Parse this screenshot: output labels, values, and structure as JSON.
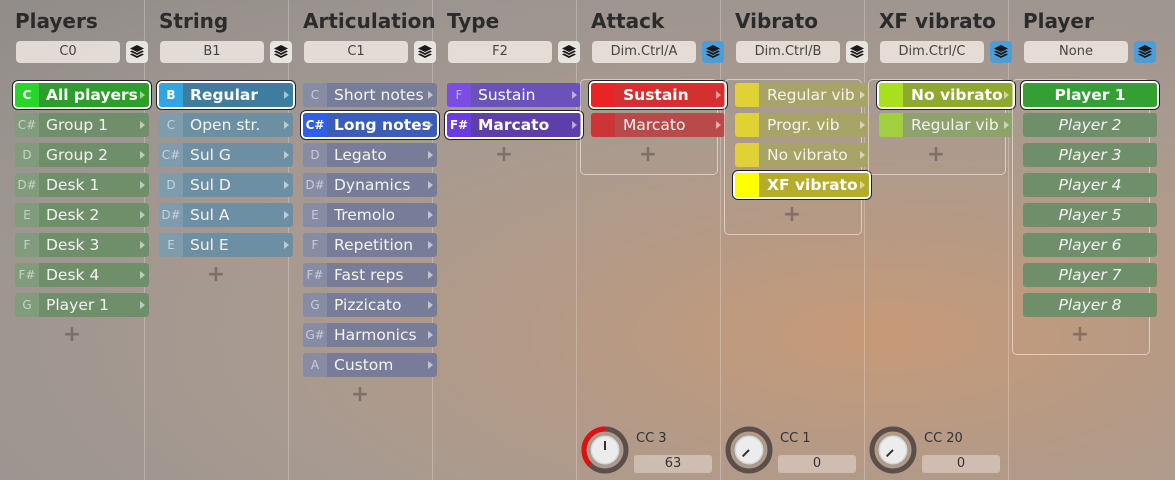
{
  "columns": [
    {
      "title": "Players",
      "key": "C0",
      "layer_active": false,
      "items": [
        {
          "key": "C",
          "label": "All players",
          "selected": true,
          "bg": "#2f9d2a",
          "key_bg": "#27d62a",
          "fg": "#ffffff"
        },
        {
          "key": "C#",
          "label": "Group 1",
          "bg": "#6f8f6b",
          "fg": "#f3f3f0"
        },
        {
          "key": "D",
          "label": "Group 2",
          "bg": "#6f8f6b",
          "fg": "#f3f3f0"
        },
        {
          "key": "D#",
          "label": "Desk 1",
          "bg": "#6f8f6b",
          "fg": "#f3f3f0"
        },
        {
          "key": "E",
          "label": "Desk 2",
          "bg": "#6f8f6b",
          "fg": "#f3f3f0"
        },
        {
          "key": "F",
          "label": "Desk 3",
          "bg": "#6f8f6b",
          "fg": "#f3f3f0"
        },
        {
          "key": "F#",
          "label": "Desk 4",
          "bg": "#6f8f6b",
          "fg": "#f3f3f0"
        },
        {
          "key": "G",
          "label": "Player 1",
          "bg": "#6f8f6b",
          "fg": "#f3f3f0"
        }
      ]
    },
    {
      "title": "String",
      "key": "B1",
      "layer_active": false,
      "items": [
        {
          "key": "B",
          "label": "Regular",
          "selected": true,
          "bg": "#3d7ea0",
          "key_bg": "#2fa6df",
          "fg": "#ffffff"
        },
        {
          "key": "C",
          "label": "Open str.",
          "bg": "#6d8fa3",
          "fg": "#f3f3f0"
        },
        {
          "key": "C#",
          "label": "Sul G",
          "bg": "#6d8fa3",
          "fg": "#f3f3f0"
        },
        {
          "key": "D",
          "label": "Sul D",
          "bg": "#6d8fa3",
          "fg": "#f3f3f0"
        },
        {
          "key": "D#",
          "label": "Sul A",
          "bg": "#6d8fa3",
          "fg": "#f3f3f0"
        },
        {
          "key": "E",
          "label": "Sul E",
          "bg": "#6d8fa3",
          "fg": "#f3f3f0"
        }
      ]
    },
    {
      "title": "Articulation",
      "key": "C1",
      "layer_active": false,
      "items": [
        {
          "key": "C",
          "label": "Short notes",
          "bg": "#777d98",
          "fg": "#f3f3f0"
        },
        {
          "key": "C#",
          "label": "Long notes",
          "selected": true,
          "bg": "#3b5db8",
          "key_bg": "#2f5fe6",
          "fg": "#ffffff"
        },
        {
          "key": "D",
          "label": "Legato",
          "bg": "#777d98",
          "fg": "#f3f3f0"
        },
        {
          "key": "D#",
          "label": "Dynamics",
          "bg": "#777d98",
          "fg": "#f3f3f0"
        },
        {
          "key": "E",
          "label": "Tremolo",
          "bg": "#777d98",
          "fg": "#f3f3f0"
        },
        {
          "key": "F",
          "label": "Repetition",
          "bg": "#777d98",
          "fg": "#f3f3f0"
        },
        {
          "key": "F#",
          "label": "Fast reps",
          "bg": "#777d98",
          "fg": "#f3f3f0"
        },
        {
          "key": "G",
          "label": "Pizzicato",
          "bg": "#777d98",
          "fg": "#f3f3f0"
        },
        {
          "key": "G#",
          "label": "Harmonics",
          "bg": "#777d98",
          "fg": "#f3f3f0"
        },
        {
          "key": "A",
          "label": "Custom",
          "bg": "#777d98",
          "fg": "#f3f3f0"
        }
      ]
    },
    {
      "title": "Type",
      "key": "F2",
      "layer_active": false,
      "items": [
        {
          "key": "F",
          "label": "Sustain",
          "bg": "#6b52b8",
          "key_bg": "#7a4ee0",
          "fg": "#ffffff"
        },
        {
          "key": "F#",
          "label": "Marcato",
          "selected": true,
          "bg": "#5e3ea8",
          "key_bg": "#6b3ae0",
          "fg": "#ffffff"
        }
      ]
    },
    {
      "title": "Attack",
      "key": "Dim.Ctrl/A",
      "layer_active": true,
      "items": [
        {
          "key": "",
          "label": "Sustain",
          "selected": true,
          "bg": "#d43030",
          "key_bg": "#e82424",
          "fg": "#ffffff"
        },
        {
          "key": "",
          "label": "Marcato",
          "bg": "#b84a4a",
          "key_bg": "#cc3535",
          "fg": "#f3f3f0"
        }
      ],
      "knob": {
        "label": "CC 3",
        "value": "63",
        "level": 0.5,
        "arc_color": "#e01010"
      }
    },
    {
      "title": "Vibrato",
      "key": "Dim.Ctrl/B",
      "layer_active": false,
      "items": [
        {
          "key": "",
          "label": "Regular vib",
          "bg": "#a8a366",
          "key_bg": "#e0d234",
          "fg": "#f3f3f0"
        },
        {
          "key": "",
          "label": "Progr. vib",
          "bg": "#a8a366",
          "key_bg": "#e0d234",
          "fg": "#f3f3f0"
        },
        {
          "key": "",
          "label": "No vibrato",
          "bg": "#a8a366",
          "key_bg": "#e0d234",
          "fg": "#f3f3f0"
        },
        {
          "key": "",
          "label": "XF vibrato",
          "selected": true,
          "bg": "#b5ac2c",
          "key_bg": "#ffff00",
          "fg": "#ffffff"
        }
      ],
      "knob": {
        "label": "CC 1",
        "value": "0",
        "level": 0,
        "arc_color": "#e01010"
      }
    },
    {
      "title": "XF vibrato",
      "key": "Dim.Ctrl/C",
      "layer_active": true,
      "items": [
        {
          "key": "",
          "label": "No vibrato",
          "selected": true,
          "bg": "#8fa830",
          "key_bg": "#a8e020",
          "fg": "#ffffff"
        },
        {
          "key": "",
          "label": "Regular vib",
          "bg": "#8ea36c",
          "key_bg": "#a0d040",
          "fg": "#f3f3f0"
        }
      ],
      "knob": {
        "label": "CC 20",
        "value": "0",
        "level": 0,
        "arc_color": "#e01010"
      }
    },
    {
      "title": "Player",
      "key": "None",
      "layer_active": true,
      "items": [
        {
          "key": "",
          "label": "Player 1",
          "selected": true,
          "bg": "#34a034",
          "key_bg": "#2adc2a",
          "fg": "#ffffff",
          "italic": false,
          "full": true
        },
        {
          "key": "",
          "label": "Player 2",
          "bg": "#6f8f6b",
          "fg": "#f3f3f0",
          "italic": true,
          "full": true
        },
        {
          "key": "",
          "label": "Player 3",
          "bg": "#6f8f6b",
          "fg": "#f3f3f0",
          "italic": true,
          "full": true
        },
        {
          "key": "",
          "label": "Player 4",
          "bg": "#6f8f6b",
          "fg": "#f3f3f0",
          "italic": true,
          "full": true
        },
        {
          "key": "",
          "label": "Player 5",
          "bg": "#6f8f6b",
          "fg": "#f3f3f0",
          "italic": true,
          "full": true
        },
        {
          "key": "",
          "label": "Player 6",
          "bg": "#6f8f6b",
          "fg": "#f3f3f0",
          "italic": true,
          "full": true
        },
        {
          "key": "",
          "label": "Player 7",
          "bg": "#6f8f6b",
          "fg": "#f3f3f0",
          "italic": true,
          "full": true
        },
        {
          "key": "",
          "label": "Player 8",
          "bg": "#6f8f6b",
          "fg": "#f3f3f0",
          "italic": true,
          "full": true
        }
      ]
    }
  ],
  "icons": {
    "layer": "layers-icon",
    "add": "plus-icon",
    "knob": "knob-icon"
  },
  "add_symbol": "+"
}
